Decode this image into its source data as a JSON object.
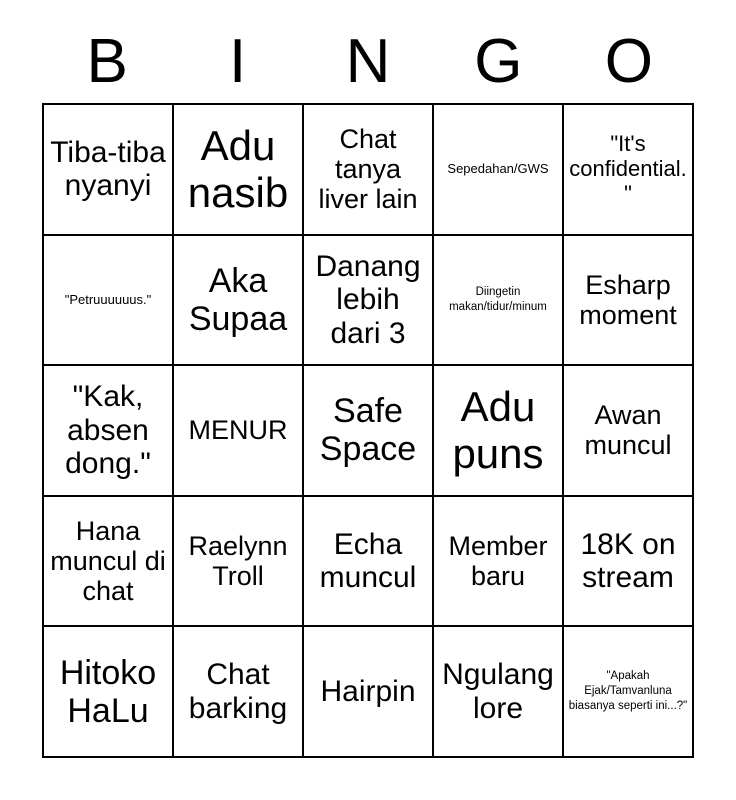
{
  "header": {
    "letters": [
      "B",
      "I",
      "N",
      "G",
      "O"
    ]
  },
  "grid": {
    "rows": 5,
    "columns": 5,
    "border_color": "#000000",
    "background_color": "#ffffff",
    "text_color": "#000000"
  },
  "cells": [
    {
      "text": "Tiba-tiba nyanyi",
      "size": "l"
    },
    {
      "text": "Adu nasib",
      "size": "xxl"
    },
    {
      "text": "Chat tanya liver lain",
      "size": "m"
    },
    {
      "text": "Sepedahan/GWS",
      "size": "xs"
    },
    {
      "text": "\"It's confidential.\"",
      "size": "s"
    },
    {
      "text": "\"Petruuuuuus.\"",
      "size": "xs"
    },
    {
      "text": "Aka Supaa",
      "size": "xl"
    },
    {
      "text": "Danang lebih dari 3",
      "size": "l"
    },
    {
      "text": "Diingetin makan/tidur/minum",
      "size": "xxs"
    },
    {
      "text": "Esharp moment",
      "size": "m"
    },
    {
      "text": "\"Kak, absen dong.\"",
      "size": "l"
    },
    {
      "text": "MENUR",
      "size": "m"
    },
    {
      "text": "Safe Space",
      "size": "xl"
    },
    {
      "text": "Adu puns",
      "size": "xxl"
    },
    {
      "text": "Awan muncul",
      "size": "m"
    },
    {
      "text": "Hana muncul di chat",
      "size": "m"
    },
    {
      "text": "Raelynn Troll",
      "size": "m"
    },
    {
      "text": "Echa muncul",
      "size": "l"
    },
    {
      "text": "Member baru",
      "size": "m"
    },
    {
      "text": "18K on stream",
      "size": "l"
    },
    {
      "text": "Hitoko HaLu",
      "size": "xl"
    },
    {
      "text": "Chat barking",
      "size": "l"
    },
    {
      "text": "Hairpin",
      "size": "l"
    },
    {
      "text": "Ngulang lore",
      "size": "l"
    },
    {
      "text": "\"Apakah Ejak/Tamvanluna biasanya seperti ini...?\"",
      "size": "xxs"
    }
  ]
}
